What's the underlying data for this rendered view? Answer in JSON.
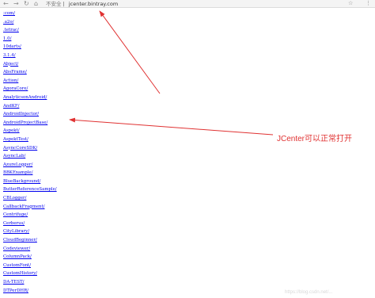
{
  "browser": {
    "back_icon": "←",
    "forward_icon": "→",
    "reload_icon": "↻",
    "home_icon": "⌂",
    "security_label": "不安全",
    "separator": "|",
    "url": "jcenter.bintray.com",
    "bookmark_icon": "☆",
    "menu_icon": "⋮"
  },
  "directory": {
    "links": [
      ":com/",
      ".a2o/",
      ".tetrac/",
      "1.0/",
      "10darts/",
      "3.1.4/",
      "Abject/",
      "AbsFrame/",
      "Action/",
      "AgoraCore/",
      "AnalyticsonAndroid/",
      "AndKF/",
      "AndroidInjector/",
      "AndroidProjectBase/",
      "Aspekt/",
      "AspektTest/",
      "AsyncCoreSDK/",
      "AsyncLab/",
      "AzureLogger/",
      "BBKExample/",
      "BlueBackground/",
      "ButterReferenceSample/",
      "CBLogger/",
      "CallbackFragment/",
      "Centrifuge/",
      "Cerberus/",
      "CityLibrary/",
      "CloudBeginner/",
      "Codeviewer/",
      "ColumnPack/",
      "CustomFont/",
      "CustomHistory/",
      "DA-TEST/",
      "DTPerDHR/"
    ]
  },
  "annotation": {
    "text": "JCenter可以正常打开",
    "color": "#e03232"
  },
  "watermark": "https://blog.csdn.net/...",
  "colors": {
    "link": "#0000ee",
    "arrow": "#e03232"
  }
}
